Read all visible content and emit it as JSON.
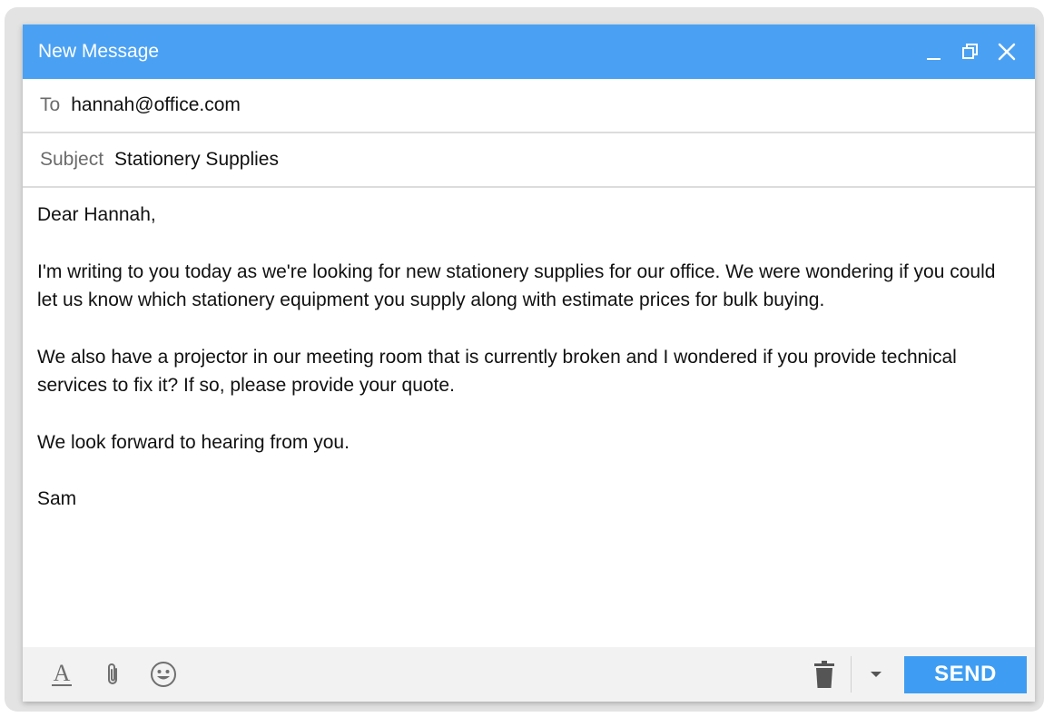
{
  "window": {
    "title": "New Message",
    "accent_color": "#4aa1f4",
    "controls": [
      "minimize-icon",
      "restore-icon",
      "close-icon"
    ]
  },
  "to": {
    "label": "To",
    "value": "hannah@office.com"
  },
  "subject": {
    "label": "Subject",
    "value": "Stationery Supplies"
  },
  "body": {
    "greeting": "Dear Hannah,",
    "paragraphs": [
      "I'm writing to you today as we're looking for new stationery supplies for our office. We were wondering if you could let us know which stationery equipment you supply along with estimate prices for bulk buying.",
      "We also have a projector in our meeting room that is currently broken and I wondered if you provide technical services to fix it? If so, please provide your quote.",
      "We look forward to hearing from you."
    ],
    "signature": "Sam"
  },
  "toolbar": {
    "left_icons": [
      "text-format-icon",
      "attachment-icon",
      "emoji-icon"
    ],
    "right_icons": [
      "trash-icon",
      "chevron-down-icon"
    ],
    "send_label": "SEND",
    "send_color": "#3e9df2"
  }
}
